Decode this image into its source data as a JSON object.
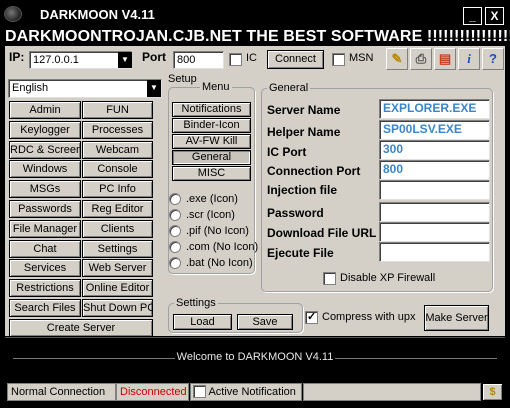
{
  "window": {
    "title": "DARKMOON V4.11",
    "minimize_label": "_",
    "close_label": "X"
  },
  "banner": "DARKMOONTROJAN.CJB.NET THE BEST SOFTWARE !!!!!!!!!!!!!!!!!!!",
  "connection": {
    "ip_label": "IP:",
    "ip_value": "127.0.0.1",
    "port_label": "Port",
    "port_value": "800",
    "ic_label": "IC",
    "connect_label": "Connect",
    "msn_label": "MSN"
  },
  "toolbar_icons": [
    "paint-icon",
    "printer-icon",
    "open-folder-icon",
    "info-icon",
    "help-icon"
  ],
  "language": "English",
  "commands": [
    [
      "Admin",
      "FUN"
    ],
    [
      "Keylogger",
      "Processes"
    ],
    [
      "RDC & Screen",
      "Webcam"
    ],
    [
      "Windows",
      "Console"
    ],
    [
      "MSGs",
      "PC Info"
    ],
    [
      "Passwords",
      "Reg Editor"
    ],
    [
      "File Manager",
      "Clients"
    ],
    [
      "Chat",
      "Settings"
    ],
    [
      "Services",
      "Web Server"
    ],
    [
      "Restrictions",
      "Online Editor"
    ],
    [
      "Search Files",
      "Shut Down PC"
    ]
  ],
  "create_server_label": "Create Server",
  "setup": {
    "title": "Setup",
    "menu_title": "Menu",
    "menu_items": [
      "Notifications",
      "Binder-Icon",
      "AV-FW Kill",
      "General",
      "MISC"
    ],
    "selected_menu": "General",
    "icon_options": [
      ".exe (Icon)",
      ".scr (Icon)",
      ".pif (No Icon)",
      ".com (No Icon)",
      ".bat (No Icon)"
    ]
  },
  "general": {
    "title": "General",
    "server_name_label": "Server Name",
    "server_name_value": "EXPLORER.EXE",
    "helper_name_label": "Helper Name",
    "helper_name_value": "SP00LSV.EXE",
    "ic_port_label": "IC Port",
    "ic_port_value": "300",
    "connection_port_label": "Connection Port",
    "connection_port_value": "800",
    "injection_file_label": "Injection file",
    "password_label": "Password",
    "download_url_label": "Download File URL",
    "ejecute_file_label": "Ejecute File",
    "disable_firewall_label": "Disable XP Firewall"
  },
  "settings": {
    "title": "Settings",
    "load_label": "Load",
    "save_label": "Save",
    "compress_label": "Compress with upx",
    "compress_checked": true,
    "make_server_label": "Make Server"
  },
  "console_text": "Welcome to DARKMOON V4.11",
  "status": {
    "mode": "Normal Connection",
    "state": "Disconnected",
    "state_color": "#cc0000",
    "active_notification_label": "Active Notification",
    "dollar_label": "$"
  }
}
